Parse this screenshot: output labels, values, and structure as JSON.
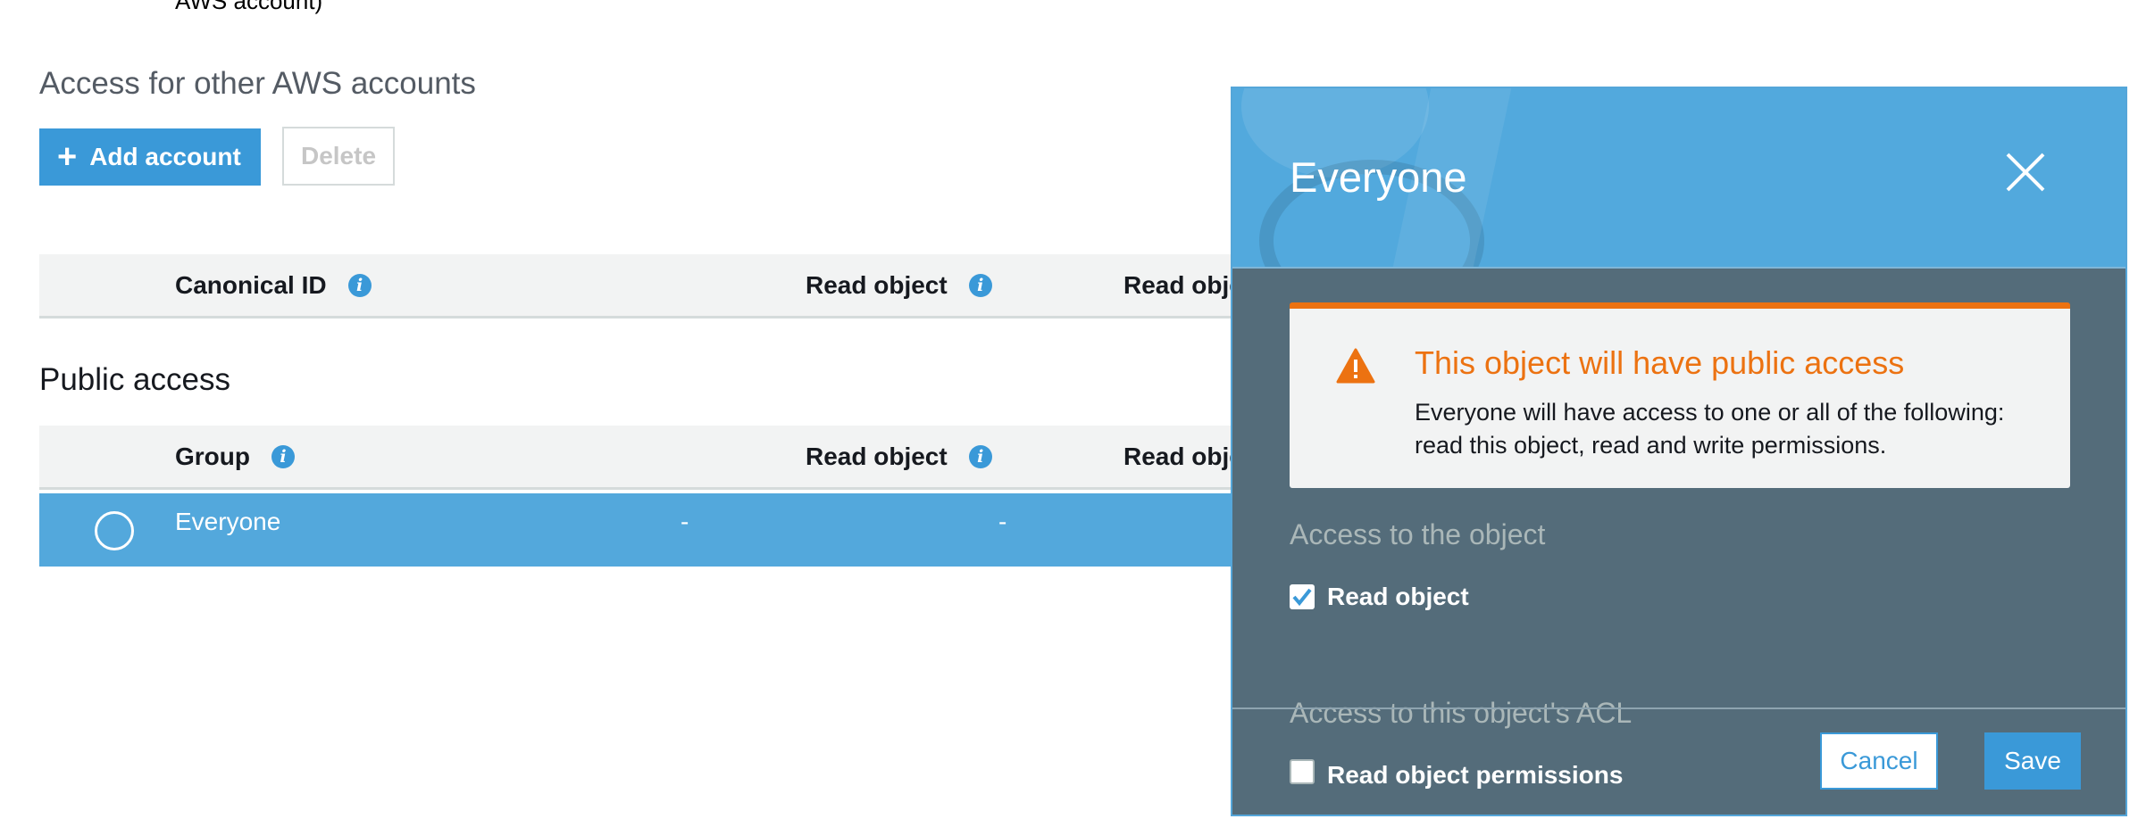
{
  "background": {
    "top_cut_text": "AWS account)",
    "other_accounts": {
      "title": "Access for other AWS accounts",
      "add_button": "Add account",
      "delete_button": "Delete",
      "columns": [
        "Canonical ID",
        "Read object",
        "Read object permis"
      ]
    },
    "public_access": {
      "title": "Public access",
      "columns": [
        "Group",
        "Read object",
        "Read object permis"
      ],
      "rows": [
        {
          "name": "Everyone",
          "read_object": "-",
          "read_permissions": "-",
          "selected": true
        }
      ]
    }
  },
  "modal": {
    "title": "Everyone",
    "alert": {
      "title": "This object will have public access",
      "body": "Everyone will have access to one or all of the following: read this object, read and write permissions."
    },
    "object_section": {
      "label": "Access to the object",
      "options": [
        {
          "label": "Read object",
          "checked": true
        }
      ]
    },
    "acl_section": {
      "label": "Access to this object's ACL",
      "options": [
        {
          "label": "Read object permissions",
          "checked": false
        }
      ]
    },
    "cancel_button": "Cancel",
    "save_button": "Save"
  },
  "colors": {
    "accent": "#3a99d8",
    "selected_row": "#53a8dc",
    "warning": "#ec7211",
    "modal_body": "#546c7a"
  },
  "icons": [
    "plus-icon",
    "info-icon",
    "radio-button",
    "close-icon",
    "warning-icon",
    "checkbox"
  ]
}
